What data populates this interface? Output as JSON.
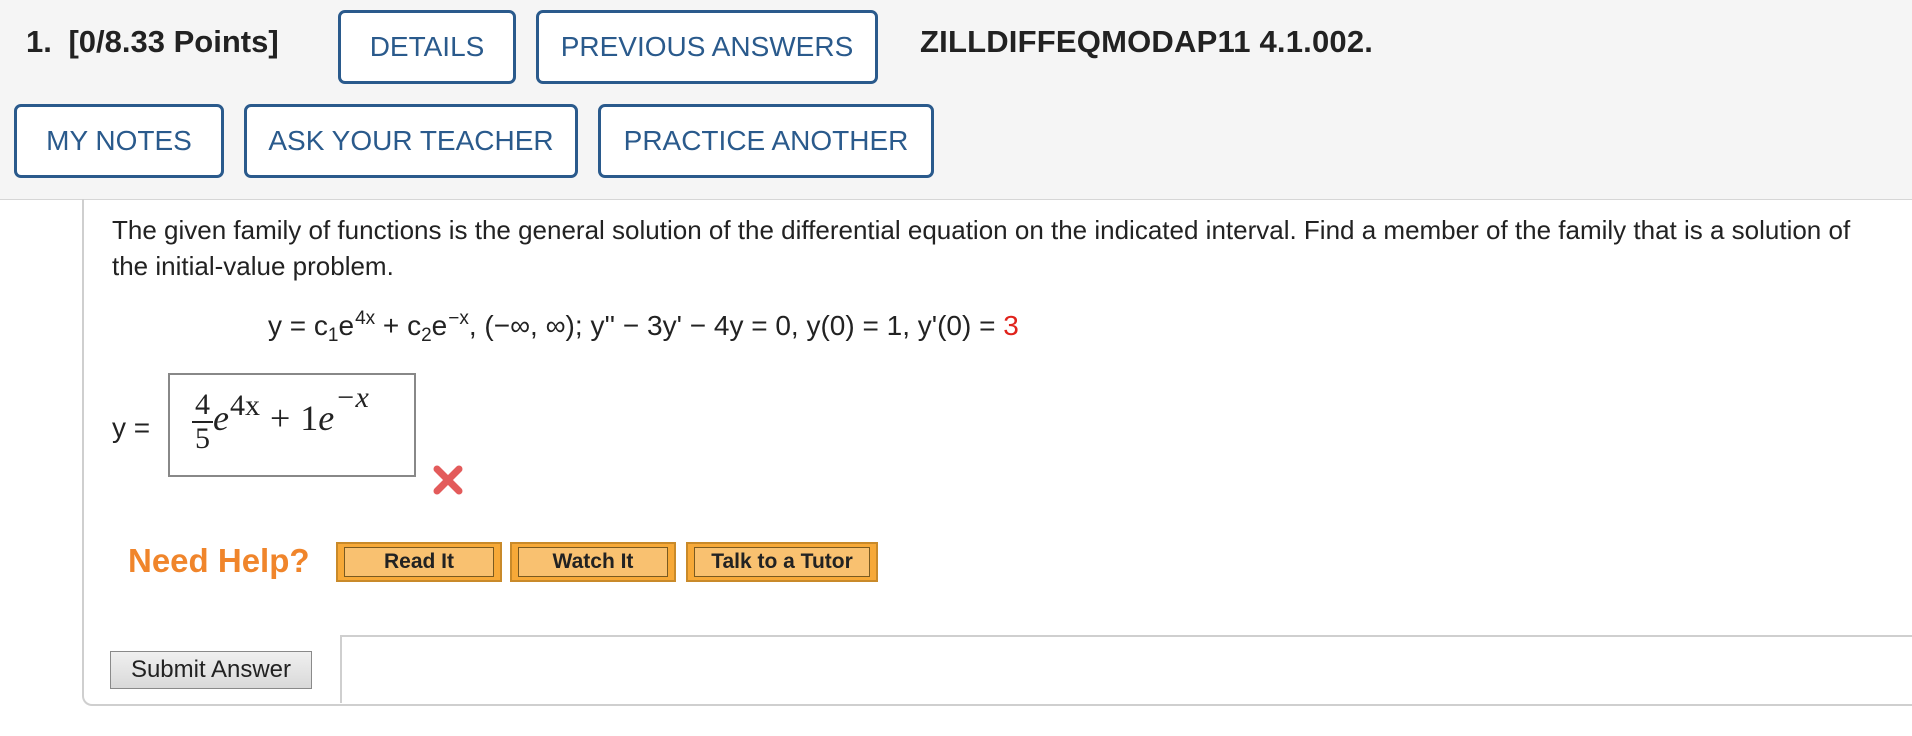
{
  "header": {
    "question_number": "1.",
    "points": "[0/8.33 Points]",
    "buttons": {
      "details": "DETAILS",
      "previous_answers": "PREVIOUS ANSWERS",
      "my_notes": "MY NOTES",
      "ask_teacher": "ASK YOUR TEACHER",
      "practice_another": "PRACTICE ANOTHER"
    },
    "problem_code": "ZILLDIFFEQMODAP11 4.1.002.",
    "accent_color": "#2a5a8c"
  },
  "problem": {
    "prompt": "The given family of functions is the general solution of the differential equation on the indicated interval. Find a member of the family that is a solution of the initial-value problem.",
    "equation": {
      "lhs": "y = c",
      "sub1": "1",
      "e1": "e",
      "exp1": "4x",
      "plus": " + c",
      "sub2": "2",
      "e2": "e",
      "exp2": "−x",
      "rest": ", (−∞, ∞); y'' − 3y' − 4y = 0, y(0) = 1, y'(0) = ",
      "highlight": "3",
      "highlight_color": "#e0231c"
    }
  },
  "answer": {
    "label": "y =",
    "frac_num": "4",
    "frac_den": "5",
    "e1": "e",
    "exp1": "4x",
    "plus": "+",
    "coef2": "1",
    "e2": "e",
    "exp2": "−x",
    "status_icon": "x-mark-icon",
    "status_color": "#e35b5b"
  },
  "help": {
    "label": "Need Help?",
    "label_color": "#f0852b",
    "buttons": [
      "Read It",
      "Watch It",
      "Talk to a Tutor"
    ]
  },
  "submit": {
    "label": "Submit Answer"
  }
}
